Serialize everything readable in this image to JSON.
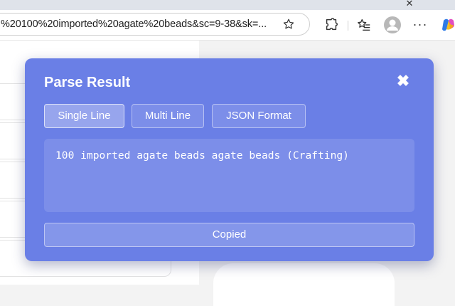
{
  "browser": {
    "address_url": "%20100%20imported%20agate%20beads&sc=9-38&sk=...",
    "window_controls": {
      "close": "✕"
    },
    "icons": [
      "star-icon",
      "extensions-icon",
      "favorites-icon",
      "profile-icon",
      "more-icon",
      "copilot-icon"
    ],
    "more_label": "···"
  },
  "popup": {
    "title": "Parse Result",
    "close_label": "✖",
    "tabs": [
      {
        "label": "Single Line",
        "active": true
      },
      {
        "label": "Multi Line",
        "active": false
      },
      {
        "label": "JSON Format",
        "active": false
      }
    ],
    "result_text": "100 imported agate beads agate beads (Crafting)",
    "copy_button_label": "Copied"
  },
  "colors": {
    "popup_bg": "#6a7fe6",
    "text": "#ffffff"
  }
}
